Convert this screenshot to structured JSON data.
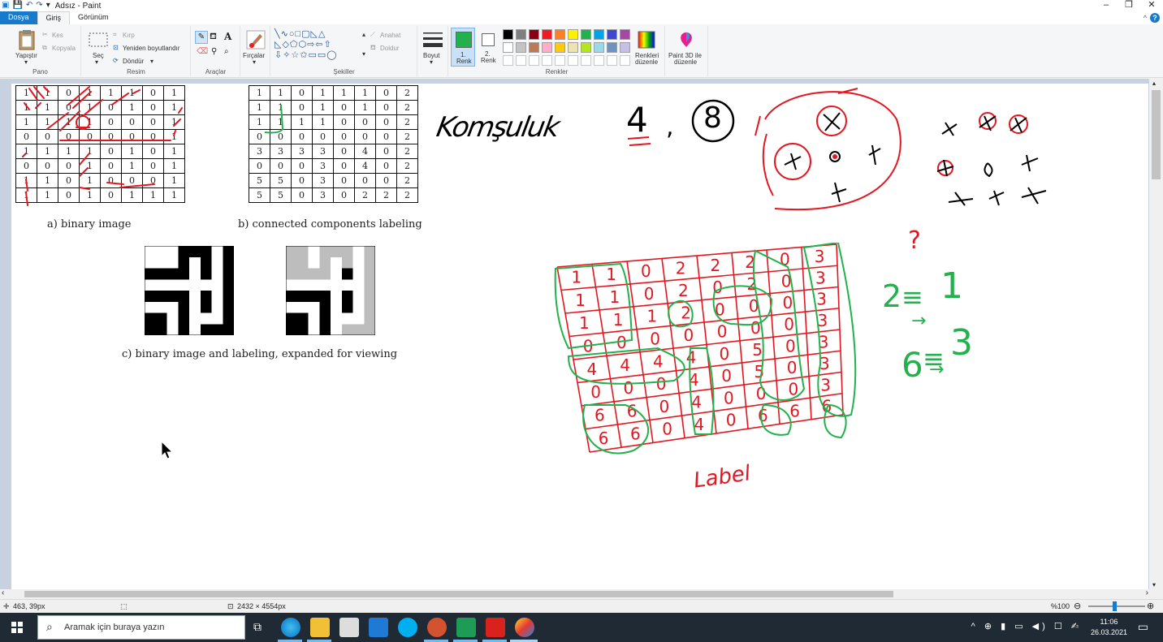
{
  "window": {
    "title": "Adsız - Paint",
    "min": "–",
    "max": "❐",
    "close": "✕"
  },
  "tabs": [
    {
      "label": "Dosya"
    },
    {
      "label": "Giriş"
    },
    {
      "label": "Görünüm"
    }
  ],
  "ribbon": {
    "pano": {
      "label": "Pano",
      "paste": "Yapıştır",
      "cut": "Kes",
      "copy": "Kopyala"
    },
    "resim": {
      "label": "Resim",
      "select": "Seç",
      "crop": "Kırp",
      "resize": "Yeniden boyutlandır",
      "rotate": "Döndür"
    },
    "araclar": {
      "label": "Araçlar",
      "brushes": "Fırçalar"
    },
    "sekiller": {
      "label": "Şekiller",
      "outline": "Anahat",
      "fill": "Doldur"
    },
    "size": "Boyut",
    "renkler": {
      "label": "Renkler",
      "color1_label": "1.",
      "color1_sub": "Renk",
      "color2_label": "2.",
      "color2_sub": "Renk",
      "edit_colors_1": "Renkleri",
      "edit_colors_2": "düzenle",
      "paint3d_1": "Paint 3D ile",
      "paint3d_2": "düzenle",
      "color1_hex": "#22b14c",
      "color2_hex": "#ffffff",
      "palette_row1": [
        "#000000",
        "#7f7f7f",
        "#880015",
        "#ed1c24",
        "#ff7f27",
        "#fff200",
        "#22b14c",
        "#00a2e8",
        "#3f48cc",
        "#a349a4"
      ],
      "palette_row2": [
        "#ffffff",
        "#c3c3c3",
        "#b97a57",
        "#ffaec9",
        "#ffc90e",
        "#efe4b0",
        "#b5e61d",
        "#99d9ea",
        "#7092be",
        "#c8bfe7"
      ]
    }
  },
  "figure": {
    "table_a": [
      [
        "1",
        "1",
        "0",
        "1",
        "1",
        "1",
        "0",
        "1"
      ],
      [
        "1",
        "1",
        "0",
        "1",
        "0",
        "1",
        "0",
        "1"
      ],
      [
        "1",
        "1",
        "1",
        "1",
        "0",
        "0",
        "0",
        "1"
      ],
      [
        "0",
        "0",
        "0",
        "0",
        "0",
        "0",
        "0",
        "1"
      ],
      [
        "1",
        "1",
        "1",
        "1",
        "0",
        "1",
        "0",
        "1"
      ],
      [
        "0",
        "0",
        "0",
        "1",
        "0",
        "1",
        "0",
        "1"
      ],
      [
        "1",
        "1",
        "0",
        "1",
        "0",
        "0",
        "0",
        "1"
      ],
      [
        "1",
        "1",
        "0",
        "1",
        "0",
        "1",
        "1",
        "1"
      ]
    ],
    "table_b": [
      [
        "1",
        "1",
        "0",
        "1",
        "1",
        "1",
        "0",
        "2"
      ],
      [
        "1",
        "1",
        "0",
        "1",
        "0",
        "1",
        "0",
        "2"
      ],
      [
        "1",
        "1",
        "1",
        "1",
        "0",
        "0",
        "0",
        "2"
      ],
      [
        "0",
        "0",
        "0",
        "0",
        "0",
        "0",
        "0",
        "2"
      ],
      [
        "3",
        "3",
        "3",
        "3",
        "0",
        "4",
        "0",
        "2"
      ],
      [
        "0",
        "0",
        "0",
        "3",
        "0",
        "4",
        "0",
        "2"
      ],
      [
        "5",
        "5",
        "0",
        "3",
        "0",
        "0",
        "0",
        "2"
      ],
      [
        "5",
        "5",
        "0",
        "3",
        "0",
        "2",
        "2",
        "2"
      ]
    ],
    "caption_a": "a) binary image",
    "caption_b": "b) connected components labeling",
    "caption_c": "c) binary image and labeling, expanded for viewing"
  },
  "annotations": {
    "komsuluk": "Komşuluk",
    "four": "4",
    "comma": ",",
    "eight": "8",
    "question": "?",
    "eq1_left": "2",
    "eq1_right": "1",
    "eq2_left": "6",
    "eq2_right": "3",
    "label_word": "Label",
    "hand_grid": [
      [
        "1",
        "1",
        "0",
        "2",
        "2",
        "2",
        "0",
        "3"
      ],
      [
        "1",
        "1",
        "0",
        "2",
        "0",
        "2",
        "0",
        "3"
      ],
      [
        "1",
        "1",
        "1",
        "2",
        "0",
        "0",
        "0",
        "3"
      ],
      [
        "0",
        "0",
        "0",
        "0",
        "0",
        "0",
        "0",
        "3"
      ],
      [
        "4",
        "4",
        "4",
        "4",
        "0",
        "5",
        "0",
        "3"
      ],
      [
        "0",
        "0",
        "0",
        "4",
        "0",
        "5",
        "0",
        "3"
      ],
      [
        "6",
        "6",
        "0",
        "4",
        "0",
        "0",
        "0",
        "3"
      ],
      [
        "6",
        "6",
        "0",
        "4",
        "0",
        "6",
        "6",
        "6"
      ]
    ]
  },
  "status": {
    "cursor_pos": "463, 39px",
    "canvas_size": "2432 × 4554px",
    "zoom": "%100"
  },
  "taskbar": {
    "search_placeholder": "Aramak için buraya yazın",
    "time": "11:06",
    "date": "26.03.2021"
  }
}
